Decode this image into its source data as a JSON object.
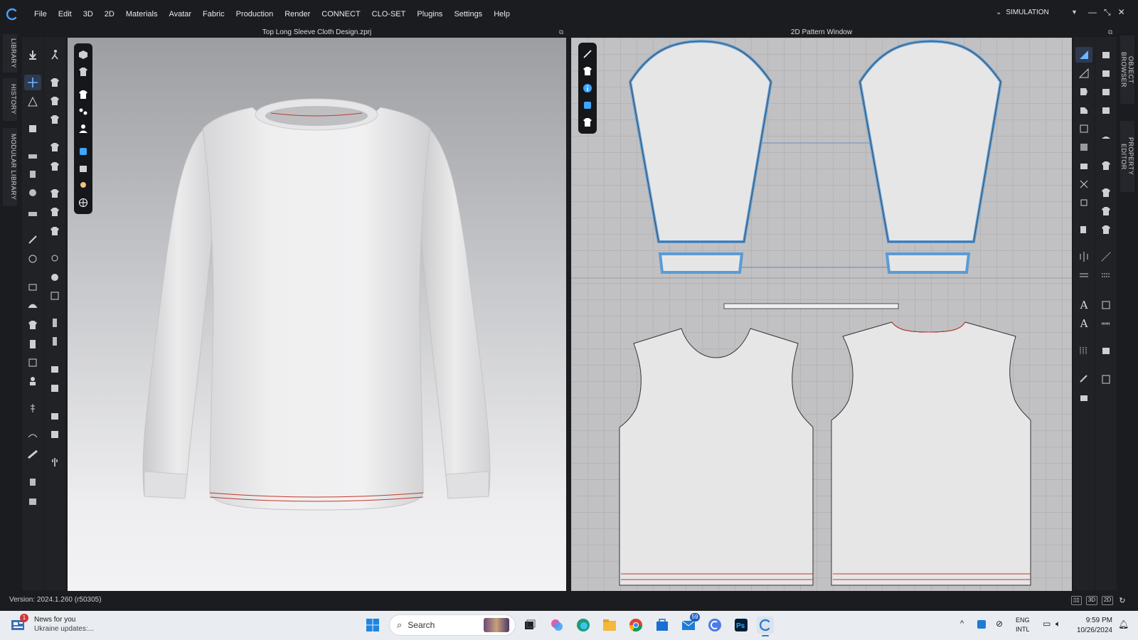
{
  "menubar": {
    "items": [
      "File",
      "Edit",
      "3D",
      "2D",
      "Materials",
      "Avatar",
      "Fabric",
      "Production",
      "Render",
      "CONNECT",
      "CLO-SET",
      "Plugins",
      "Settings",
      "Help"
    ],
    "mode": "SIMULATION"
  },
  "left_dock": {
    "tabs": [
      "LIBRARY",
      "HISTORY",
      "MODULAR LIBRARY"
    ]
  },
  "right_dock": {
    "tabs": [
      "OBJECT BROWSER",
      "PROPERTY EDITOR"
    ]
  },
  "viewport3d": {
    "title": "Top Long Sleeve Cloth Design.zprj"
  },
  "viewport2d": {
    "title": "2D Pattern Window"
  },
  "statusbar": {
    "version": "Version: 2024.1.260 (r50305)",
    "view_modes": [
      "▯▯",
      "3D",
      "2D"
    ]
  },
  "taskbar": {
    "news_title": "News for you",
    "news_sub": "Ukraine updates:...",
    "news_badge": "1",
    "search_label": "Search",
    "mail_badge": "59",
    "lang_top": "ENG",
    "lang_bottom": "INTL",
    "time": "9:59 PM",
    "date": "10/26/2024"
  },
  "colors": {
    "accent": "#4a90e2",
    "pattern_outline": "#5b9bd5",
    "seam_red": "#c0392b",
    "ui_dark": "#1b1c20",
    "taskbar": "#e9ecf1"
  }
}
